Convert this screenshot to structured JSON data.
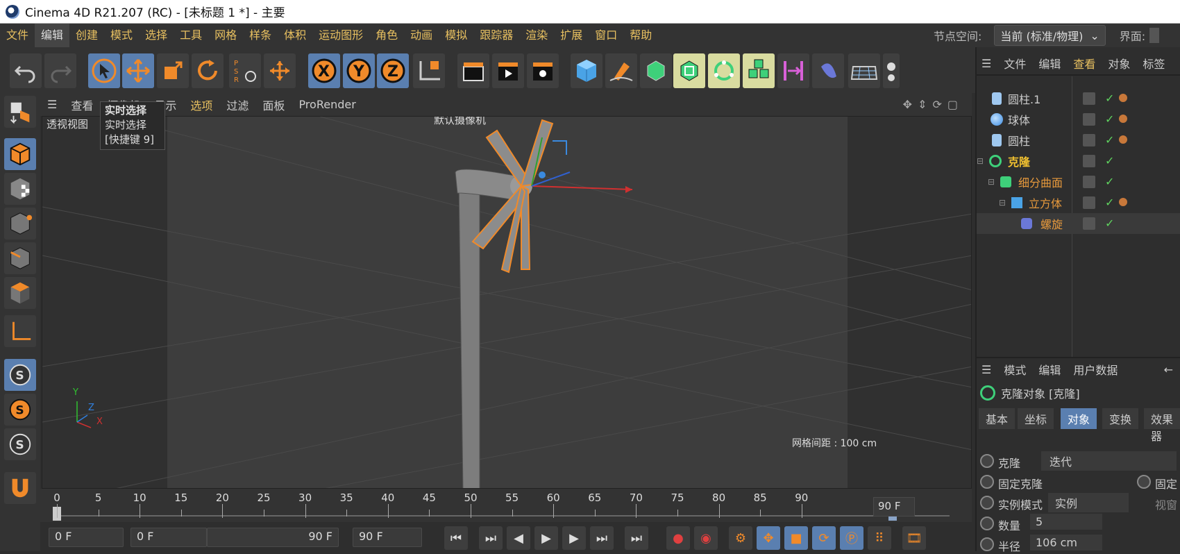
{
  "window": {
    "title": "Cinema 4D R21.207 (RC) - [未标题 1 *] - 主要"
  },
  "menu": [
    "文件",
    "编辑",
    "创建",
    "模式",
    "选择",
    "工具",
    "网格",
    "样条",
    "体积",
    "运动图形",
    "角色",
    "动画",
    "模拟",
    "跟踪器",
    "渲染",
    "扩展",
    "窗口",
    "帮助"
  ],
  "nodespace": {
    "label": "节点空间:",
    "value": "当前 (标准/物理)",
    "layout_label": "界面:"
  },
  "viewport": {
    "menu": [
      "查看",
      "摄像机",
      "显示",
      "选项",
      "过滤",
      "面板",
      "ProRender"
    ],
    "view_name": "透视视图",
    "camera_label": "默认摄像机",
    "grid_spacing": "网格间距 : 100 cm",
    "axes": {
      "x": "X",
      "y": "Y",
      "z": "Z"
    }
  },
  "tooltip": {
    "title": "实时选择",
    "desc": "实时选择",
    "shortcut": "[快捷键 9]"
  },
  "timeline": {
    "ticks": [
      "0",
      "5",
      "10",
      "15",
      "20",
      "25",
      "30",
      "35",
      "40",
      "45",
      "50",
      "55",
      "60",
      "65",
      "70",
      "75",
      "80",
      "85",
      "90"
    ],
    "end_frame": "90 F"
  },
  "transport": {
    "current": "0 F",
    "range_start": "0 F",
    "range_end": "90 F",
    "max": "90 F"
  },
  "objects": {
    "menu": [
      "文件",
      "编辑",
      "查看",
      "对象",
      "标签"
    ],
    "items": [
      {
        "name": "圆柱.1",
        "color": "#cccccc",
        "icon": "cylinder-icon"
      },
      {
        "name": "球体",
        "color": "#cccccc",
        "icon": "sphere-icon"
      },
      {
        "name": "圆柱",
        "color": "#cccccc",
        "icon": "cylinder-icon"
      },
      {
        "name": "克隆",
        "color": "#f0c030",
        "icon": "cloner-icon"
      },
      {
        "name": "细分曲面",
        "color": "#e89a3c",
        "icon": "subdivision-icon"
      },
      {
        "name": "立方体",
        "color": "#e89a3c",
        "icon": "cube-icon"
      },
      {
        "name": "螺旋",
        "color": "#e89a3c",
        "icon": "twist-icon"
      }
    ]
  },
  "attributes": {
    "menu": [
      "模式",
      "编辑",
      "用户数据"
    ],
    "object_title": "克隆对象 [克隆]",
    "tabs": [
      "基本",
      "坐标",
      "对象",
      "变换",
      "效果器"
    ],
    "active_tab": "对象",
    "rows": {
      "clone_label": "克隆",
      "clone_value": "迭代",
      "fixed_clone_label": "固定克隆",
      "fixed_label": "固定",
      "instance_mode_label": "实例模式",
      "instance_mode_value": "实例",
      "render_label": "视窗",
      "count_label": "数量",
      "count_value": "5",
      "radius_label": "半径",
      "radius_value": "106 cm"
    }
  },
  "colors": {
    "accent": "#e8c060",
    "highlight": "#5a7fb0",
    "selection": "#f08a2a"
  }
}
